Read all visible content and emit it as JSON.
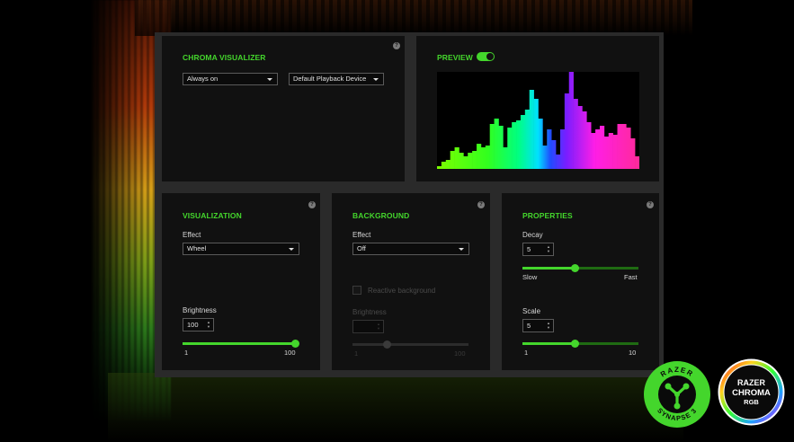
{
  "chroma_visualizer": {
    "title": "CHROMA VISUALIZER",
    "mode_value": "Always on",
    "device_value": "Default Playback Device"
  },
  "preview": {
    "title": "PREVIEW",
    "enabled": true,
    "spectrum_bars": [
      3,
      8,
      10,
      20,
      24,
      18,
      14,
      18,
      20,
      28,
      24,
      26,
      50,
      56,
      48,
      24,
      46,
      52,
      54,
      60,
      66,
      88,
      78,
      56,
      26,
      44,
      32,
      16,
      44,
      84,
      108,
      78,
      70,
      64,
      52,
      40,
      44,
      48,
      36,
      40,
      38,
      50,
      50,
      46,
      34,
      14
    ]
  },
  "visualization": {
    "title": "VISUALIZATION",
    "effect_label": "Effect",
    "effect_value": "Wheel",
    "brightness_label": "Brightness",
    "brightness_value": "100",
    "brightness_min": "1",
    "brightness_max": "100",
    "brightness_fraction": 1.0
  },
  "background": {
    "title": "BACKGROUND",
    "effect_label": "Effect",
    "effect_value": "Off",
    "reactive_label": "Reactive background",
    "brightness_label": "Brightness",
    "brightness_min": "1",
    "brightness_max": "100",
    "brightness_fraction": 0.3
  },
  "properties": {
    "title": "PROPERTIES",
    "decay_label": "Decay",
    "decay_value": "5",
    "decay_min": "Slow",
    "decay_max": "Fast",
    "decay_fraction": 0.45,
    "scale_label": "Scale",
    "scale_value": "5",
    "scale_min": "1",
    "scale_max": "10",
    "scale_fraction": 0.45
  },
  "badges": {
    "synapse_top": "RAZER",
    "synapse_bottom": "SYNAPSE 3",
    "chroma_line1": "RAZER",
    "chroma_line2": "CHROMA",
    "chroma_line3": "RGB"
  },
  "colors": {
    "accent": "#44d62c",
    "panel": "#111111",
    "frame": "#2a2a2a"
  }
}
